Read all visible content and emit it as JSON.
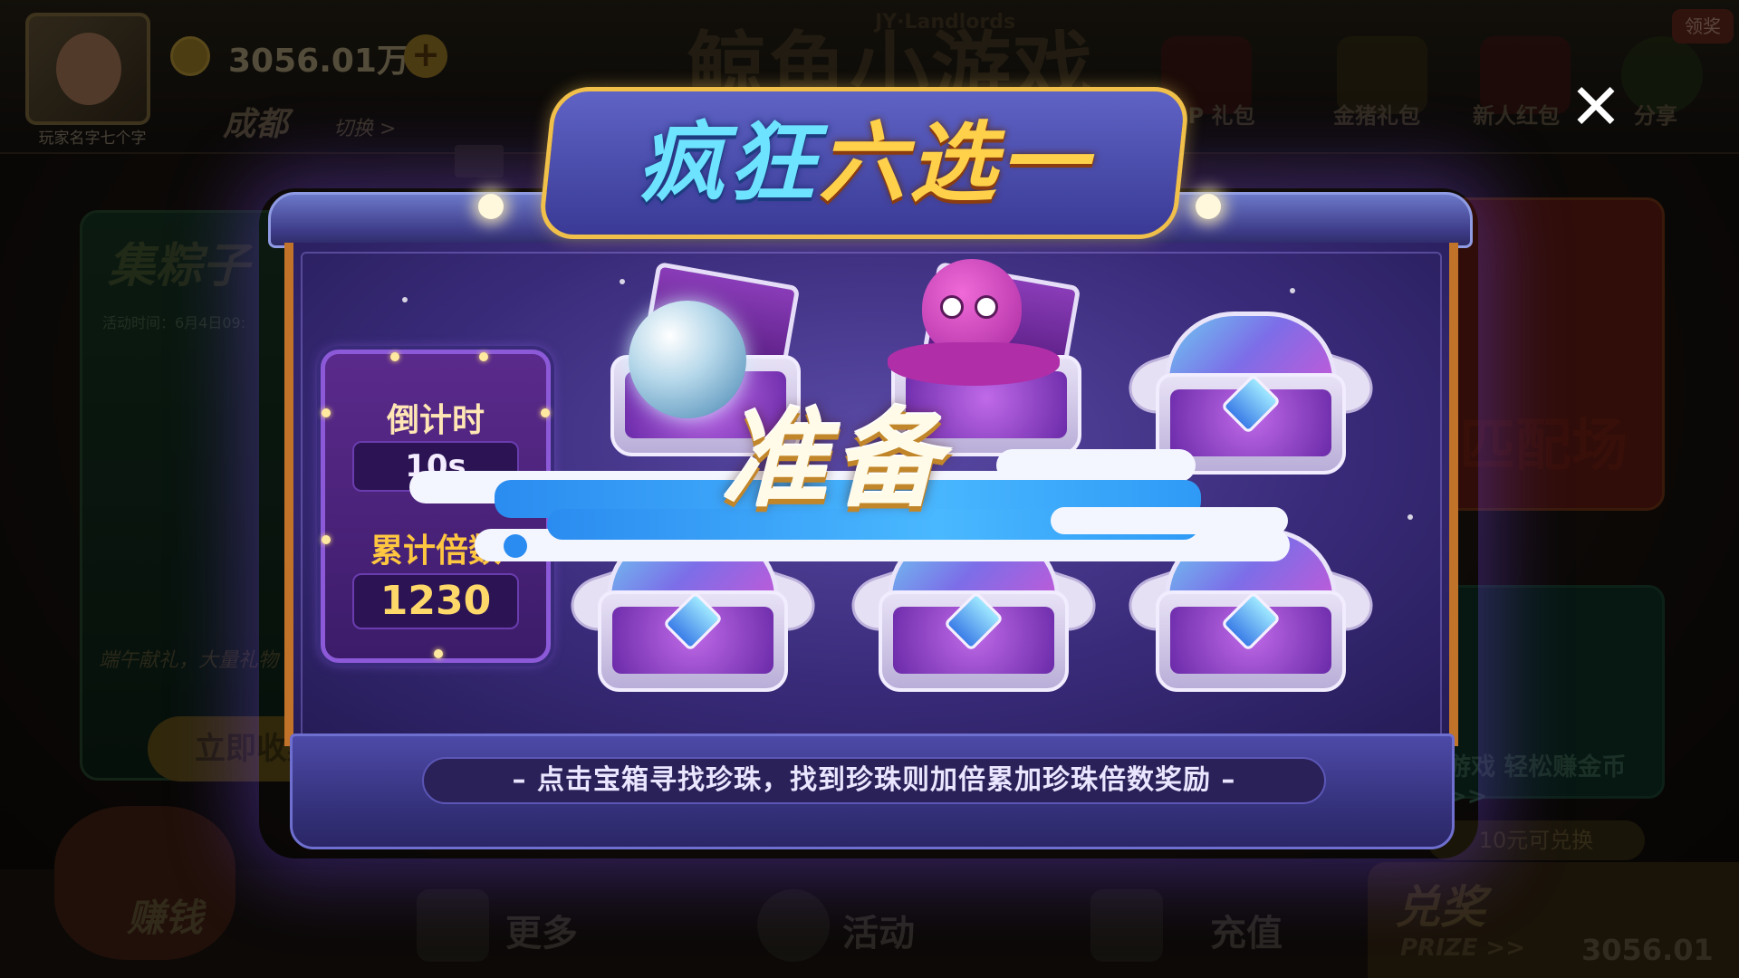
{
  "background": {
    "player_name": "玩家名字七个字",
    "coin_amount": "3056.01万",
    "coin_add_label": "+",
    "city": "成都",
    "switch_label": "切换 >",
    "logo": {
      "main": "鲸鱼小游戏",
      "sub": "JY·Landlords"
    },
    "top_icons": [
      {
        "label": "VIP 礼包",
        "icon": "crown-icon"
      },
      {
        "label": "金猪礼包",
        "icon": "golden-pig-icon"
      },
      {
        "label": "新人红包",
        "icon": "red-envelope-icon"
      },
      {
        "label": "分享",
        "icon": "wechat-icon"
      }
    ],
    "claim_badge": "领奖",
    "left_card": {
      "title": "集粽子",
      "time": "活动时间：6月4日09:",
      "footer": "端午献礼，大量礼物",
      "button": "立即收集"
    },
    "right_card": {
      "title": "匹配场"
    },
    "right_card2": {
      "text": "游戏 轻松赚金币 >>"
    },
    "exchange_tip": "10元可兑换",
    "prize": {
      "title": "兑奖",
      "sub": "PRIZE >>",
      "amount": "3056.01"
    },
    "bottom_nav": [
      {
        "label": "赚钱",
        "icon": "fortune-god-icon"
      },
      {
        "label": "更多",
        "icon": "grid-icon"
      },
      {
        "label": "活动",
        "icon": "activity-icon"
      },
      {
        "label": "充值",
        "icon": "cart-icon"
      }
    ],
    "sound_icon": "speaker-icon"
  },
  "modal": {
    "title_part1": "疯狂",
    "title_part2": "六选一",
    "close_icon": "close-icon",
    "countdown_label": "倒计时",
    "countdown_value": "10s",
    "multiplier_label": "累计倍数",
    "multiplier_value": "1230",
    "ready_text": "准备",
    "description": "– 点击宝箱寻找珍珠，找到珍珠则加倍累加珍珠倍数奖励 –",
    "chests": [
      {
        "state": "open",
        "content": "pearl"
      },
      {
        "state": "open",
        "content": "octopus"
      },
      {
        "state": "closed",
        "content": ""
      },
      {
        "state": "closed",
        "content": ""
      },
      {
        "state": "closed",
        "content": ""
      },
      {
        "state": "closed",
        "content": ""
      }
    ],
    "colors": {
      "frame_gold": "#f0c04a",
      "panel_purple": "#3a2b7a",
      "ready_banner_blue": "#2a8cf0"
    }
  }
}
